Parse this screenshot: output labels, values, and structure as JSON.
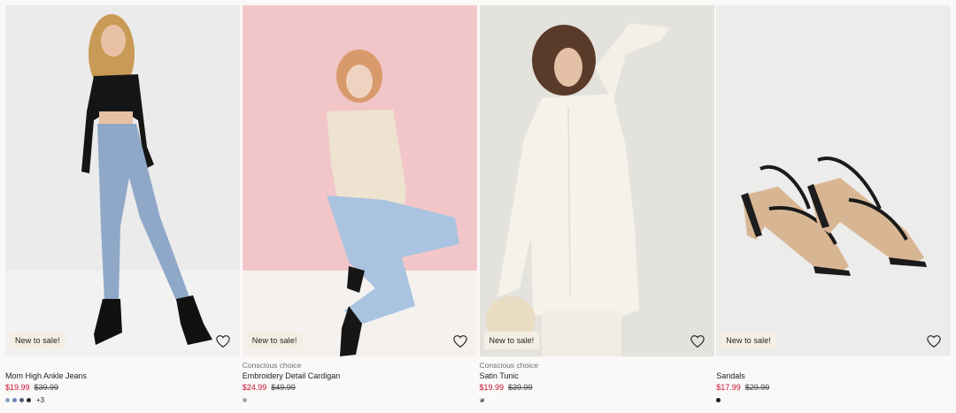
{
  "products": [
    {
      "image_label": "model in black crop top, light blue jeans and black boots",
      "badge": "New to sale!",
      "conscious": "",
      "title": "Mom High Ankle Jeans",
      "sale_price": "$19.99",
      "original_price": "$39.99",
      "swatches": [
        "#8fa4c4",
        "#6b87b0",
        "#4a5d7a",
        "#2a2a2a"
      ],
      "more_colors": "+3"
    },
    {
      "image_label": "model in cream embroidered cardigan sitting on pink backdrop",
      "badge": "New to sale!",
      "conscious": "Conscious choice",
      "title": "Embroidery Detail Cardigan",
      "sale_price": "$24.99",
      "original_price": "$49.99",
      "swatches": [
        "#a8a8a8"
      ],
      "more_colors": ""
    },
    {
      "image_label": "model in off-white satin tunic",
      "badge": "New to sale!",
      "conscious": "Conscious choice",
      "title": "Satin Tunic",
      "sale_price": "$19.99",
      "original_price": "$39.99",
      "swatches": [
        "#6a6a6a"
      ],
      "more_colors": ""
    },
    {
      "image_label": "pair of black strappy block-heel sandals",
      "badge": "New to sale!",
      "conscious": "",
      "title": "Sandals",
      "sale_price": "$17.99",
      "original_price": "$29.99",
      "swatches": [
        "#1a1a1a"
      ],
      "more_colors": ""
    }
  ],
  "watermark": "Chi n2Zau",
  "colors": {
    "sale": "#c8102e",
    "badge_bg": "#f4eee4",
    "page_bg": "#faf9f8"
  },
  "icons": {
    "favorite": "heart-outline-icon"
  }
}
